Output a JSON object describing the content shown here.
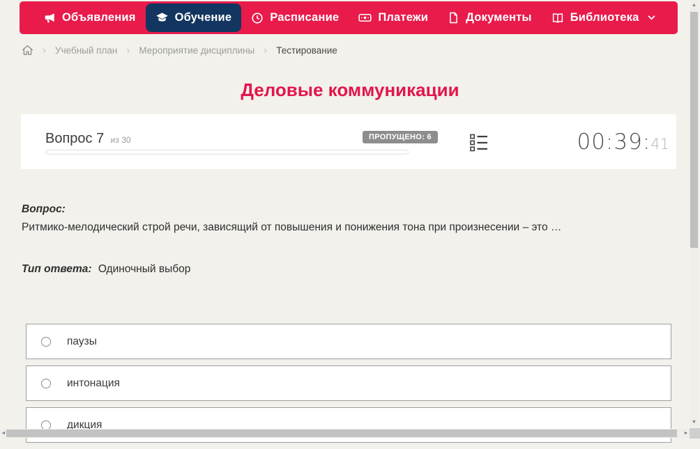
{
  "colors": {
    "accent_red": "#e81b4b",
    "title_red": "#e2164b",
    "active_navy": "#123660"
  },
  "nav": {
    "items": [
      {
        "label": "Объявления"
      },
      {
        "label": "Обучение",
        "active": true
      },
      {
        "label": "Расписание"
      },
      {
        "label": "Платежи"
      },
      {
        "label": "Документы"
      },
      {
        "label": "Библиотека",
        "has_dropdown": true
      }
    ]
  },
  "breadcrumb": {
    "separator": "›",
    "items": [
      "Учебный план",
      "Мероприятие дисциплины",
      "Тестирование"
    ]
  },
  "page": {
    "title": "Деловые коммуникации"
  },
  "quiz": {
    "question_label": "Вопрос 7",
    "question_total": "из 30",
    "skipped_badge": "ПРОПУЩЕНО: 6",
    "timer_main": "00:39:",
    "timer_seconds": "41",
    "question_heading": "Вопрос:",
    "question_text": "Ритмико-мелодический строй речи, зависящий от повышения и понижения тона при произнесении – это …",
    "answer_type_label": "Тип ответа:",
    "answer_type_value": "Одиночный выбор",
    "options": [
      {
        "label": "паузы"
      },
      {
        "label": "интонация"
      },
      {
        "label": "дикция"
      }
    ]
  },
  "scrollbars": {
    "up": "▲",
    "down": "▼",
    "left": "◄",
    "right": "►"
  }
}
